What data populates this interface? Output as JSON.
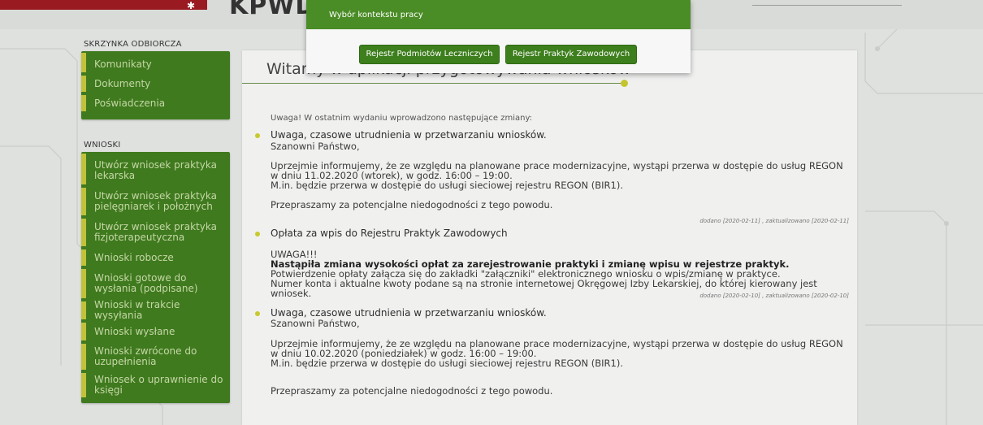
{
  "brand": {
    "partial_title": "KPWDL",
    "emblem": "eagle-emblem"
  },
  "dialog": {
    "title": "Wybór kontekstu pracy",
    "buttons": [
      "Rejestr Podmiotów Leczniczych",
      "Rejestr Praktyk Zawodowych"
    ]
  },
  "sidebar": {
    "inbox_heading": "SKRZYNKA ODBIORCZA",
    "inbox_items": [
      "Komunikaty",
      "Dokumenty",
      "Poświadczenia"
    ],
    "applications_heading": "WNIOSKI",
    "applications_items": [
      "Utwórz wniosek praktyka lekarska",
      "Utwórz wniosek praktyka pielęgniarek i położnych",
      "Utwórz wniosek praktyka fizjoterapeutyczna",
      "Wnioski robocze",
      "Wnioski gotowe do wysłania (podpisane)",
      "Wnioski w trakcie wysyłania",
      "Wnioski wysłane",
      "Wnioski zwrócone do uzupełnienia",
      "Wniosek o uprawnienie do księgi"
    ]
  },
  "main": {
    "welcome": "Witamy w aplikacji przygotowywania wniosków",
    "intro": "Uwaga! W ostatnim wydaniu wprowadzono następujące zmiany:",
    "news": [
      {
        "title": "Uwaga, czasowe utrudnienia w przetwarzaniu wniosków.",
        "greeting": "Szanowni Państwo,",
        "line1": "Uprzejmie informujemy, że ze względu na planowane prace modernizacyjne, wystąpi przerwa w dostępie do usług REGON",
        "line2": "w dniu 11.02.2020 (wtorek), w godz. 16:00 – 19:00.",
        "line3": "M.in. będzie przerwa w dostępie do usługi sieciowej rejestru REGON (BIR1).",
        "line4": "Przepraszamy za potencjalne niedogodności z tego powodu.",
        "meta": "dodano [2020-02-11] , zaktualizowano [2020-02-11]"
      },
      {
        "title": "Opłata za wpis do Rejestru Praktyk Zawodowych",
        "alert": "UWAGA!!!",
        "bold_line": "Nastąpiła zmiana wysokości opłat za zarejestrowanie praktyki i zmianę wpisu w rejestrze praktyk.",
        "line1": "Potwierdzenie opłaty załącza się do zakładki \"załączniki\" elektronicznego wniosku o wpis/zmianę w praktyce.",
        "line2": "Numer konta i aktualne kwoty podane są na stronie internetowej Okręgowej Izby Lekarskiej, do której kierowany jest",
        "line3": "wniosek.",
        "meta": "dodano [2020-02-10] , zaktualizowano [2020-02-10]"
      },
      {
        "title": "Uwaga, czasowe utrudnienia w przetwarzaniu wniosków.",
        "greeting": "Szanowni Państwo,",
        "line1": "Uprzejmie informujemy, że ze względu na planowane prace modernizacyjne, wystąpi przerwa w dostępie do usług REGON",
        "line2": "w dniu 10.02.2020 (poniedziałek) w godz. 16:00 – 19:00.",
        "line3": "M.in. będzie przerwa w dostępie do usługi sieciowej rejestru REGON (BIR1).",
        "line4": "Przepraszamy za potencjalne niedogodności z tego powodu."
      }
    ]
  }
}
